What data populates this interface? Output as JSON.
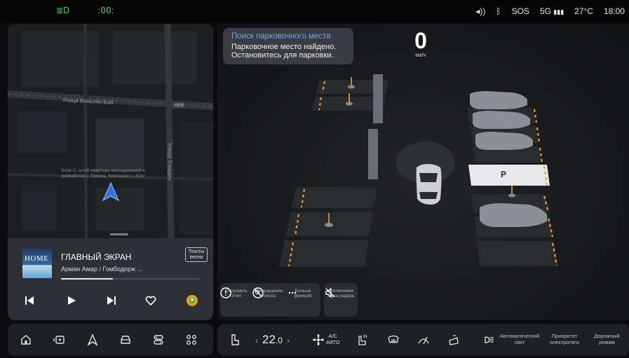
{
  "status_bar": {
    "left_icons": [
      "headlight-icon",
      "parking-light-icon"
    ],
    "sound_icon": "speaker-icon",
    "bluetooth_icon": "bluetooth-icon",
    "sos": "SOS",
    "network": "5G",
    "temperature": "27°C",
    "time": "18:00"
  },
  "map": {
    "road_horizontal": "Улица Вэньлян Бэй",
    "road_vertical": "Улица Хэншин",
    "road_badge": "Y805",
    "poi_label": "Блок С, штаб-квартира исследований и разработок г. Пекина, Компания Li Auto",
    "position_icon": "navigation-arrow-icon"
  },
  "media": {
    "cover_text": "HOME",
    "title": "ГЛАВНЫЙ ЭКРАН",
    "artist": "Арман Амар / Гомбодорж ...",
    "lyrics_button": "Тексты песни",
    "progress": 0.37,
    "controls": [
      "previous-icon",
      "play-icon",
      "next-icon",
      "heart-icon",
      "app-icon"
    ]
  },
  "parking": {
    "notice_title": "Поиск парковочного места",
    "notice_body_line1": "Парковочное место найдено.",
    "notice_body_line2": "Остановитесь для парковки.",
    "speed_value": "0",
    "speed_unit": "км/ч",
    "slot_marker": "P",
    "actions": [
      {
        "label_line1": "Отправить",
        "label_line2": "отчет",
        "icon": "info-icon"
      },
      {
        "label_line1": "Прекращение",
        "label_line2": "поиска",
        "icon": "stop-search-icon"
      },
      {
        "label_line1": "Больше",
        "label_line2": "функций",
        "icon": "more-icon"
      }
    ],
    "mute_action": {
      "label_line1": "Отключение",
      "label_line2": "звука радара",
      "icon": "radar-mute-icon"
    }
  },
  "dock": {
    "icons": [
      "home-icon",
      "media-icon",
      "navigation-icon",
      "vehicle-icon",
      "controls-icon",
      "apps-icon"
    ]
  },
  "climate": {
    "seat_icon": "seat-icon",
    "temperature": "22",
    "temperature_decimal": ".0",
    "ac_line1": "A/C",
    "ac_line2": "АВТО",
    "icons": [
      "fan-icon",
      "seat-heat-icon",
      "defrost-icon",
      "wiper-icon",
      "mirror-icon",
      "headlamp-icon"
    ],
    "auto_light_line1": "Автоматический",
    "auto_light_line2": "свет",
    "electric_priority_line1": "Приоритет",
    "electric_priority_line2": "электротяги",
    "road_mode_line1": "Дорожный",
    "road_mode_line2": "режим"
  },
  "colors": {
    "accent_blue": "#71a9ea",
    "status_green": "#4fd16a",
    "parking_line_orange": "#f39c23"
  }
}
